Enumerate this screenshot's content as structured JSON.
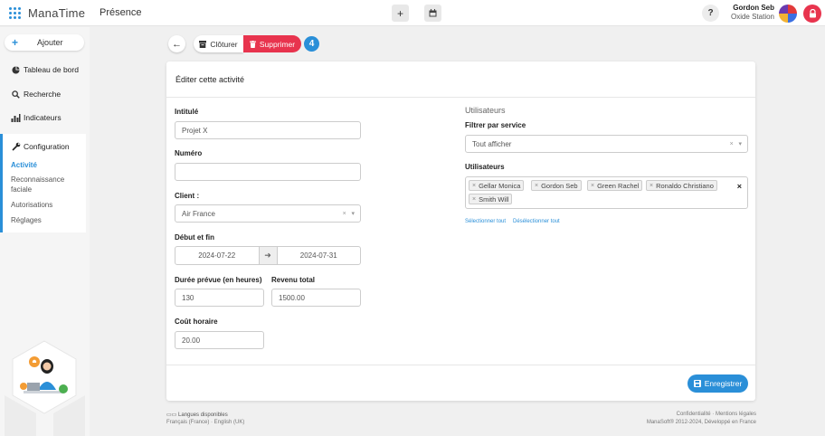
{
  "app": {
    "name": "ManaTime",
    "module": "Présence"
  },
  "header": {
    "add_icon": "plus-icon",
    "calendar_icon": "calendar-icon",
    "help_label": "?",
    "user_name": "Gordon Seb",
    "user_org": "Oxide Station"
  },
  "sidebar": {
    "add_label": "Ajouter",
    "items": [
      {
        "label": "Tableau de bord",
        "icon": "pie-chart-icon"
      },
      {
        "label": "Recherche",
        "icon": "search-icon"
      },
      {
        "label": "Indicateurs",
        "icon": "bar-chart-icon"
      }
    ],
    "config": {
      "title": "Configuration",
      "icon": "wrench-icon",
      "subitems": [
        "Activité",
        "Reconnaissance faciale",
        "Autorisations",
        "Réglages"
      ]
    }
  },
  "actions": {
    "close_label": "Clôturer",
    "delete_label": "Supprimer",
    "badge_count": "4"
  },
  "form": {
    "title": "Éditer cette activité",
    "intitule": {
      "label": "Intitulé",
      "value": "Projet X"
    },
    "numero": {
      "label": "Numéro",
      "value": ""
    },
    "client": {
      "label": "Client :",
      "value": "Air France"
    },
    "dates": {
      "label": "Début et fin",
      "start": "2024-07-22",
      "end": "2024-07-31"
    },
    "duree": {
      "label": "Durée prévue (en heures)",
      "value": "130"
    },
    "revenu": {
      "label": "Revenu total",
      "value": "1500.00"
    },
    "cout": {
      "label": "Coût horaire",
      "value": "20.00"
    }
  },
  "users_panel": {
    "title": "Utilisateurs",
    "filter_label": "Filtrer par service",
    "filter_value": "Tout afficher",
    "users_label": "Utilisateurs",
    "tags": [
      "Gellar Monica",
      "Gordon Seb",
      "Green Rachel",
      "Ronaldo Christiano",
      "Smith Will"
    ],
    "select_all": "Sélectionner tout",
    "deselect_all": "Désélectionner tout"
  },
  "save_label": "Enregistrer",
  "footer": {
    "languages_title": "Langues disponibles",
    "languages": "Français (France) · English (UK)",
    "links": "Confidentialité · Mentions légales",
    "copyright": "ManaSoft® 2012-2024, Développé en France"
  },
  "colors": {
    "accent": "#2a8fd8",
    "danger": "#e8344e"
  }
}
